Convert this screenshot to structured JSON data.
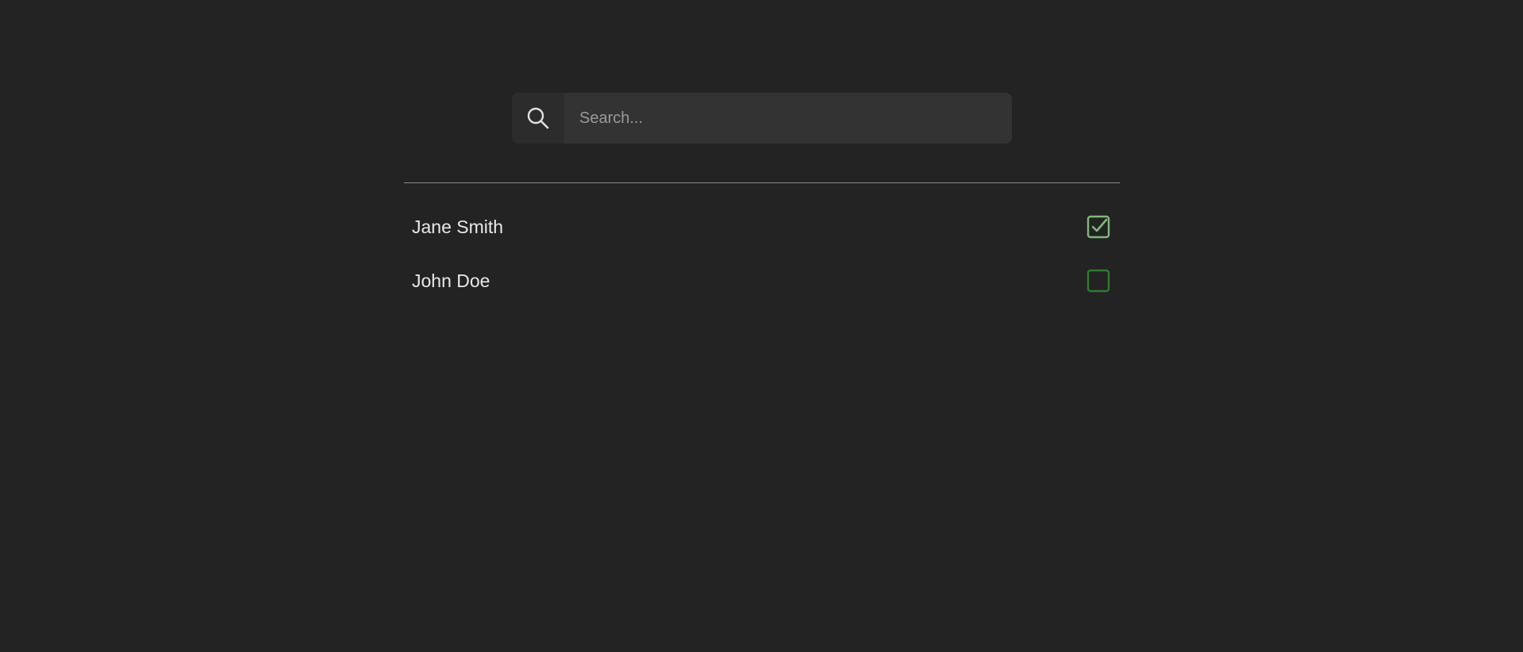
{
  "search": {
    "placeholder": "Search...",
    "value": "",
    "icon": "search-icon"
  },
  "people": [
    {
      "name": "Jane Smith",
      "checked": true
    },
    {
      "name": "John Doe",
      "checked": false
    }
  ],
  "colors": {
    "background": "#232323",
    "search_bg": "#333333",
    "divider": "#8a8a8a",
    "checked_accent": "#7fb87a",
    "unchecked_accent": "#2f7a2f"
  }
}
